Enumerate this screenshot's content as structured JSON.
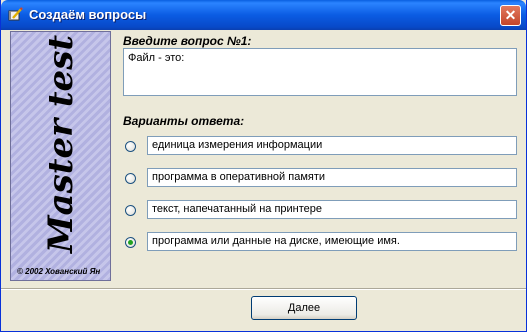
{
  "window": {
    "title": "Создаём вопросы",
    "icon": "book-pencil-icon",
    "close_label": "✕"
  },
  "sidebar": {
    "title": "Master test",
    "copyright": "© 2002 Хованский Ян",
    "background_color": "#b9b9e6"
  },
  "question": {
    "label": "Введите вопрос №1:",
    "text": "Файл - это:"
  },
  "answers": {
    "label": "Варианты ответа:",
    "items": [
      {
        "text": "единица измерения информации",
        "selected": false
      },
      {
        "text": "программа в оперативной памяти",
        "selected": false
      },
      {
        "text": "текст, напечатанный на принтере",
        "selected": false
      },
      {
        "text": "программа или данные на диске, имеющие имя.",
        "selected": true
      }
    ]
  },
  "footer": {
    "next_label": "Далее"
  },
  "colors": {
    "titlebar": "#0b5ce3",
    "dialog_bg": "#ece9d8",
    "radio_selected": "#21a121"
  }
}
